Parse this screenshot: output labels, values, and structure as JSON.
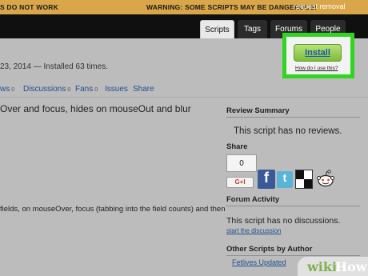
{
  "warning": {
    "left_text": "S DO NOT WORK",
    "text": "WARNING: SOME SCRIPTS MAY BE DANGEROUS!",
    "link": "request removal"
  },
  "nav": {
    "tabs": [
      {
        "label": "Scripts",
        "active": true
      },
      {
        "label": "Tags",
        "active": false
      },
      {
        "label": "Forums",
        "active": false
      },
      {
        "label": "People",
        "active": false
      }
    ]
  },
  "script": {
    "meta": "23, 2014 — Installed 63 times.",
    "subnav": [
      {
        "label": "ws",
        "count": "0"
      },
      {
        "label": "Discussions",
        "count": "0"
      },
      {
        "label": "Fans",
        "count": "0"
      },
      {
        "label": "Issues",
        "count": ""
      },
      {
        "label": "Share",
        "count": ""
      }
    ],
    "description_line1": "Over and focus, hides on mouseOut and blur",
    "description_line2": "fields, on mouseOver, focus (tabbing into the field counts) and then"
  },
  "install": {
    "button_label": "Install",
    "help_link": "How do I use this?",
    "highlight_color": "#2fd61f"
  },
  "sidebar": {
    "review_summary_heading": "Review Summary",
    "no_reviews_text": "This script has no reviews.",
    "share_heading": "Share",
    "share_count": "0",
    "gplus_label": "G+I",
    "share_icons": [
      "facebook-icon",
      "twitter-icon",
      "delicious-icon",
      "reddit-icon"
    ],
    "forum_heading": "Forum Activity",
    "no_discussions_text": "This script has no discussions.",
    "start_discussion_link": "start the discussion",
    "other_scripts_heading": "Other Scripts by Author",
    "other_scripts": [
      "Fetlives Updated"
    ]
  },
  "watermark": {
    "wiki": "wiki",
    "how": "How"
  }
}
